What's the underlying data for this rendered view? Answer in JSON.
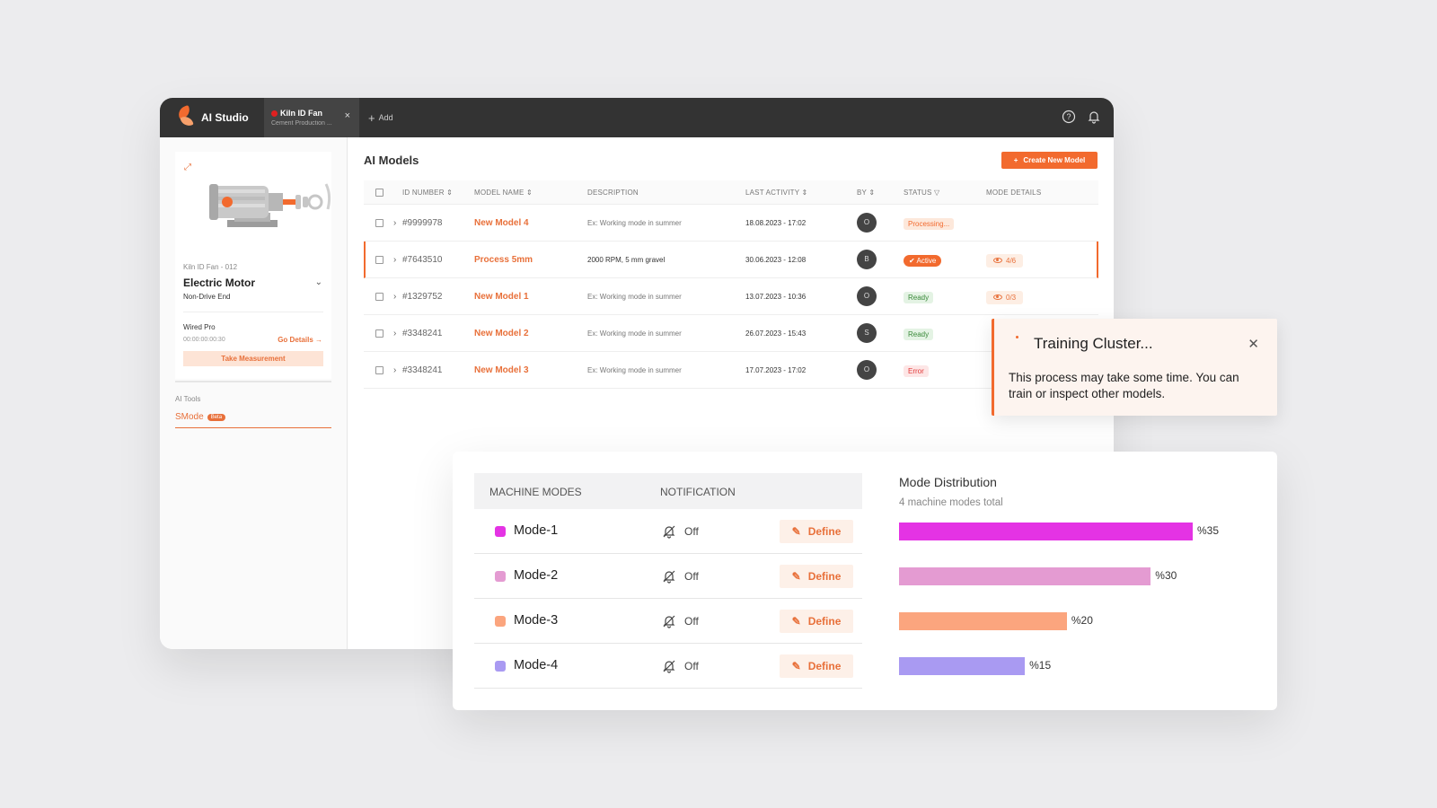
{
  "app": {
    "title": "AI Studio",
    "tab": {
      "title": "Kiln ID Fan",
      "subtitle": "Cement Production ...",
      "close": "×"
    },
    "add_label": "Add",
    "icons": [
      "help-icon",
      "bell-icon"
    ]
  },
  "sidebar": {
    "device_code": "Kiln ID Fan - 012",
    "device_name": "Electric Motor",
    "device_sub": "Non-Drive End",
    "sensor_name": "Wired Pro",
    "sensor_time": "00:00:00:00:30",
    "go_details": "Go Details →",
    "take_measurement": "Take Measurement",
    "ai_tools_label": "AI Tools",
    "smode_label": "SMode",
    "beta": "Beta"
  },
  "main": {
    "title": "AI Models",
    "create_button": "Create New Model",
    "columns": [
      "ID NUMBER",
      "MODEL NAME",
      "DESCRIPTION",
      "LAST ACTIVITY",
      "BY",
      "STATUS",
      "MODE DETAILS"
    ],
    "rows": [
      {
        "id": "#9999978",
        "name": "New Model 4",
        "desc": "Ex: Working mode in summer",
        "date": "18.08.2023 - 17:02",
        "by": "O",
        "status": "Processing...",
        "status_type": "processing",
        "mode": ""
      },
      {
        "id": "#7643510",
        "name": "Process 5mm",
        "desc": "2000 RPM, 5 mm gravel",
        "date": "30.06.2023 - 12:08",
        "by": "B",
        "status": "Active",
        "status_type": "active",
        "mode": "4/6"
      },
      {
        "id": "#1329752",
        "name": "New Model 1",
        "desc": "Ex: Working mode in summer",
        "date": "13.07.2023 - 10:36",
        "by": "O",
        "status": "Ready",
        "status_type": "ready",
        "mode": "0/3"
      },
      {
        "id": "#3348241",
        "name": "New Model 2",
        "desc": "Ex: Working mode in summer",
        "date": "26.07.2023 - 15:43",
        "by": "S",
        "status": "Ready",
        "status_type": "ready",
        "mode": ""
      },
      {
        "id": "#3348241",
        "name": "New Model 3",
        "desc": "Ex: Working mode in summer",
        "date": "17.07.2023 - 17:02",
        "by": "O",
        "status": "Error",
        "status_type": "error",
        "mode": ""
      }
    ]
  },
  "toast": {
    "title": "Training Cluster...",
    "body": "This process may take some time. You can train or inspect other models."
  },
  "modes": {
    "header_modes": "MACHINE MODES",
    "header_notification": "NOTIFICATION",
    "define_label": "Define",
    "items": [
      {
        "name": "Mode-1",
        "notification": "Off",
        "color": "#e433e4",
        "percent": 35,
        "label": "%35"
      },
      {
        "name": "Mode-2",
        "notification": "Off",
        "color": "#e49bd2",
        "percent": 30,
        "label": "%30"
      },
      {
        "name": "Mode-3",
        "notification": "Off",
        "color": "#fba57e",
        "percent": 20,
        "label": "%20"
      },
      {
        "name": "Mode-4",
        "notification": "Off",
        "color": "#a99af2",
        "percent": 15,
        "label": "%15"
      }
    ]
  },
  "distribution": {
    "title": "Mode Distribution",
    "subtitle": "4 machine modes total"
  }
}
